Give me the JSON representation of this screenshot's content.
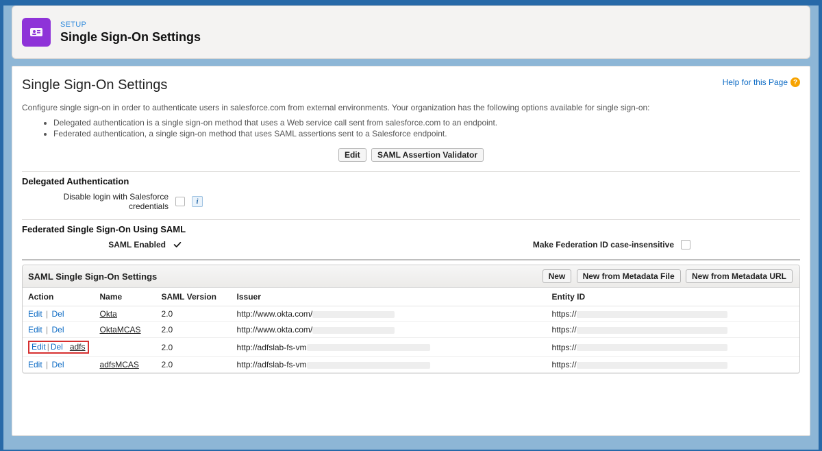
{
  "header": {
    "eyebrow": "SETUP",
    "title": "Single Sign-On Settings"
  },
  "page": {
    "title": "Single Sign-On Settings",
    "help_label": "Help for this Page",
    "intro": "Configure single sign-on in order to authenticate users in salesforce.com from external environments. Your organization has the following options available for single sign-on:",
    "bullet1": "Delegated authentication is a single sign-on method that uses a Web service call sent from salesforce.com to an endpoint.",
    "bullet2": "Federated authentication, a single sign-on method that uses SAML assertions sent to a Salesforce endpoint."
  },
  "buttons": {
    "edit": "Edit",
    "validator": "SAML Assertion Validator",
    "new": "New",
    "new_file": "New from Metadata File",
    "new_url": "New from Metadata URL"
  },
  "delegated": {
    "section": "Delegated Authentication",
    "disable_login_label": "Disable login with Salesforce credentials"
  },
  "federated": {
    "section": "Federated Single Sign-On Using SAML",
    "saml_enabled_label": "SAML Enabled",
    "fed_id_case_label": "Make Federation ID case-insensitive"
  },
  "saml_panel": {
    "title": "SAML Single Sign-On Settings",
    "columns": {
      "action": "Action",
      "name": "Name",
      "version": "SAML Version",
      "issuer": "Issuer",
      "entity": "Entity ID"
    },
    "action_edit": "Edit",
    "action_del": "Del",
    "rows": [
      {
        "name": "Okta",
        "version": "2.0",
        "issuer_prefix": "http://www.okta.com/",
        "entity_prefix": "https://",
        "highlight": false
      },
      {
        "name": "OktaMCAS",
        "version": "2.0",
        "issuer_prefix": "http://www.okta.com/",
        "entity_prefix": "https://",
        "highlight": false
      },
      {
        "name": "adfs",
        "version": "2.0",
        "issuer_prefix": "http://adfslab-fs-vm",
        "entity_prefix": "https://",
        "highlight": true
      },
      {
        "name": "adfsMCAS",
        "version": "2.0",
        "issuer_prefix": "http://adfslab-fs-vm",
        "entity_prefix": "https://",
        "highlight": false
      }
    ]
  }
}
